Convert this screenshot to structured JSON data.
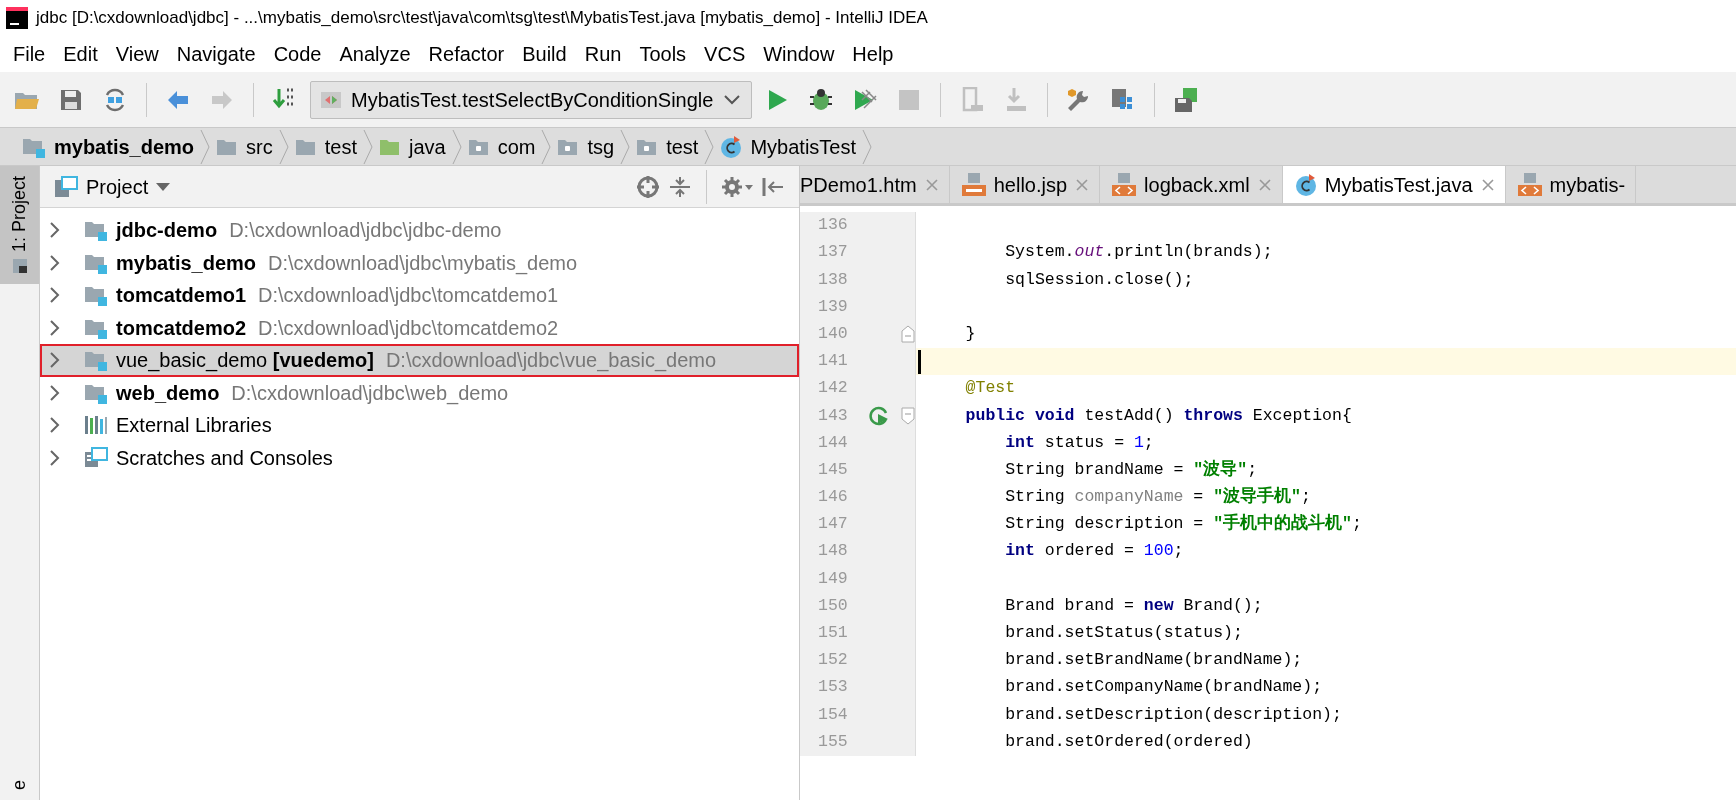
{
  "window": {
    "title": "jdbc [D:\\cxdownload\\jdbc] - ...\\mybatis_demo\\src\\test\\java\\com\\tsg\\test\\MybatisTest.java [mybatis_demo] - IntelliJ IDEA"
  },
  "menu": [
    "File",
    "Edit",
    "View",
    "Navigate",
    "Code",
    "Analyze",
    "Refactor",
    "Build",
    "Run",
    "Tools",
    "VCS",
    "Window",
    "Help"
  ],
  "toolbar": {
    "run_config": "MybatisTest.testSelectByConditionSingle"
  },
  "breadcrumb": [
    {
      "label": "mybatis_demo",
      "kind": "module"
    },
    {
      "label": "src",
      "kind": "folder"
    },
    {
      "label": "test",
      "kind": "folder"
    },
    {
      "label": "java",
      "kind": "source"
    },
    {
      "label": "com",
      "kind": "package"
    },
    {
      "label": "tsg",
      "kind": "package"
    },
    {
      "label": "test",
      "kind": "package"
    },
    {
      "label": "MybatisTest",
      "kind": "class"
    }
  ],
  "side_stripe": [
    {
      "label": "1: Project",
      "selected": true
    },
    {
      "label": "e",
      "selected": false
    }
  ],
  "project": {
    "title": "Project",
    "items": [
      {
        "name": "jdbc-demo",
        "path": "D:\\cxdownload\\jdbc\\jdbc-demo",
        "kind": "module",
        "bold": true,
        "selected": false,
        "outlined": false
      },
      {
        "name": "mybatis_demo",
        "path": "D:\\cxdownload\\jdbc\\mybatis_demo",
        "kind": "module",
        "bold": true,
        "selected": false,
        "outlined": false
      },
      {
        "name": "tomcatdemo1",
        "path": "D:\\cxdownload\\jdbc\\tomcatdemo1",
        "kind": "module",
        "bold": true,
        "selected": false,
        "outlined": false
      },
      {
        "name": "tomcatdemo2",
        "path": "D:\\cxdownload\\jdbc\\tomcatdemo2",
        "kind": "module",
        "bold": true,
        "selected": false,
        "outlined": false
      },
      {
        "name": "vue_basic_demo **[vuedemo]**",
        "path": "D:\\cxdownload\\jdbc\\vue_basic_demo",
        "kind": "module",
        "bold": false,
        "selected": true,
        "outlined": true
      },
      {
        "name": "web_demo",
        "path": "D:\\cxdownload\\jdbc\\web_demo",
        "kind": "module",
        "bold": true,
        "selected": false,
        "outlined": false
      },
      {
        "name": "External Libraries",
        "kind": "libraries",
        "bold": false,
        "selected": false,
        "outlined": false
      },
      {
        "name": "Scratches and Consoles",
        "kind": "scratches",
        "bold": false,
        "selected": false,
        "outlined": false
      }
    ]
  },
  "tabs": [
    {
      "label": "PDemo1.htm",
      "kind": "html",
      "selected": false
    },
    {
      "label": "hello.jsp",
      "kind": "jsp",
      "selected": false
    },
    {
      "label": "logback.xml",
      "kind": "xml",
      "selected": false
    },
    {
      "label": "MybatisTest.java",
      "kind": "class",
      "selected": true
    },
    {
      "label": "mybatis-",
      "kind": "xml",
      "selected": false
    }
  ],
  "editor": {
    "lines": [
      {
        "number": "136",
        "current": false
      },
      {
        "number": "137",
        "current": false,
        "tokens": [
          {
            "text": "        System.",
            "kind": "plain"
          },
          {
            "text": "out",
            "kind": "field"
          },
          {
            "text": ".println(brands);",
            "kind": "plain"
          }
        ]
      },
      {
        "number": "138",
        "current": false,
        "tokens": [
          {
            "text": "        sqlSession.close();",
            "kind": "plain"
          }
        ]
      },
      {
        "number": "139",
        "current": false
      },
      {
        "number": "140",
        "current": false,
        "fold_marker": true,
        "tokens": [
          {
            "text": "    }",
            "kind": "plain"
          }
        ]
      },
      {
        "number": "141",
        "current": true
      },
      {
        "number": "142",
        "current": false,
        "tokens": [
          {
            "text": "    @Test",
            "kind": "annotation"
          }
        ]
      },
      {
        "number": "143",
        "current": false,
        "run_marker": true,
        "fold_marker": true,
        "tokens": [
          {
            "text": "    public void",
            "kind": "keyword"
          },
          {
            "text": " testAdd() ",
            "kind": "plain"
          },
          {
            "text": "throws",
            "kind": "keyword"
          },
          {
            "text": " Exception{",
            "kind": "plain"
          }
        ]
      },
      {
        "number": "144",
        "current": false,
        "tokens": [
          {
            "text": "        int",
            "kind": "keyword"
          },
          {
            "text": " status = ",
            "kind": "plain"
          },
          {
            "text": "1",
            "kind": "number"
          },
          {
            "text": ";",
            "kind": "plain"
          }
        ]
      },
      {
        "number": "145",
        "current": false,
        "tokens": [
          {
            "text": "        String brandName = ",
            "kind": "plain"
          },
          {
            "text": "\"波导\"",
            "kind": "string"
          },
          {
            "text": ";",
            "kind": "plain"
          }
        ]
      },
      {
        "number": "146",
        "current": false,
        "tokens": [
          {
            "text": "        String ",
            "kind": "plain"
          },
          {
            "text": "companyName",
            "kind": "unused"
          },
          {
            "text": " = ",
            "kind": "plain"
          },
          {
            "text": "\"波导手机\"",
            "kind": "string"
          },
          {
            "text": ";",
            "kind": "plain"
          }
        ]
      },
      {
        "number": "147",
        "current": false,
        "tokens": [
          {
            "text": "        String description = ",
            "kind": "plain"
          },
          {
            "text": "\"手机中的战斗机\"",
            "kind": "string"
          },
          {
            "text": ";",
            "kind": "plain"
          }
        ]
      },
      {
        "number": "148",
        "current": false,
        "tokens": [
          {
            "text": "        int",
            "kind": "keyword"
          },
          {
            "text": " ordered = ",
            "kind": "plain"
          },
          {
            "text": "100",
            "kind": "number"
          },
          {
            "text": ";",
            "kind": "plain"
          }
        ]
      },
      {
        "number": "149",
        "current": false
      },
      {
        "number": "150",
        "current": false,
        "tokens": [
          {
            "text": "        Brand brand = ",
            "kind": "plain"
          },
          {
            "text": "new",
            "kind": "keyword"
          },
          {
            "text": " Brand();",
            "kind": "plain"
          }
        ]
      },
      {
        "number": "151",
        "current": false,
        "tokens": [
          {
            "text": "        brand.setStatus(status);",
            "kind": "plain"
          }
        ]
      },
      {
        "number": "152",
        "current": false,
        "tokens": [
          {
            "text": "        brand.setBrandName(brandName);",
            "kind": "plain"
          }
        ]
      },
      {
        "number": "153",
        "current": false,
        "tokens": [
          {
            "text": "        brand.setCompanyName(brandName);",
            "kind": "plain"
          }
        ]
      },
      {
        "number": "154",
        "current": false,
        "tokens": [
          {
            "text": "        brand.setDescription(description);",
            "kind": "plain"
          }
        ]
      },
      {
        "number": "155",
        "current": false,
        "tokens": [
          {
            "text": "        brand.setOrdered(ordered)",
            "kind": "plain"
          }
        ]
      }
    ]
  }
}
